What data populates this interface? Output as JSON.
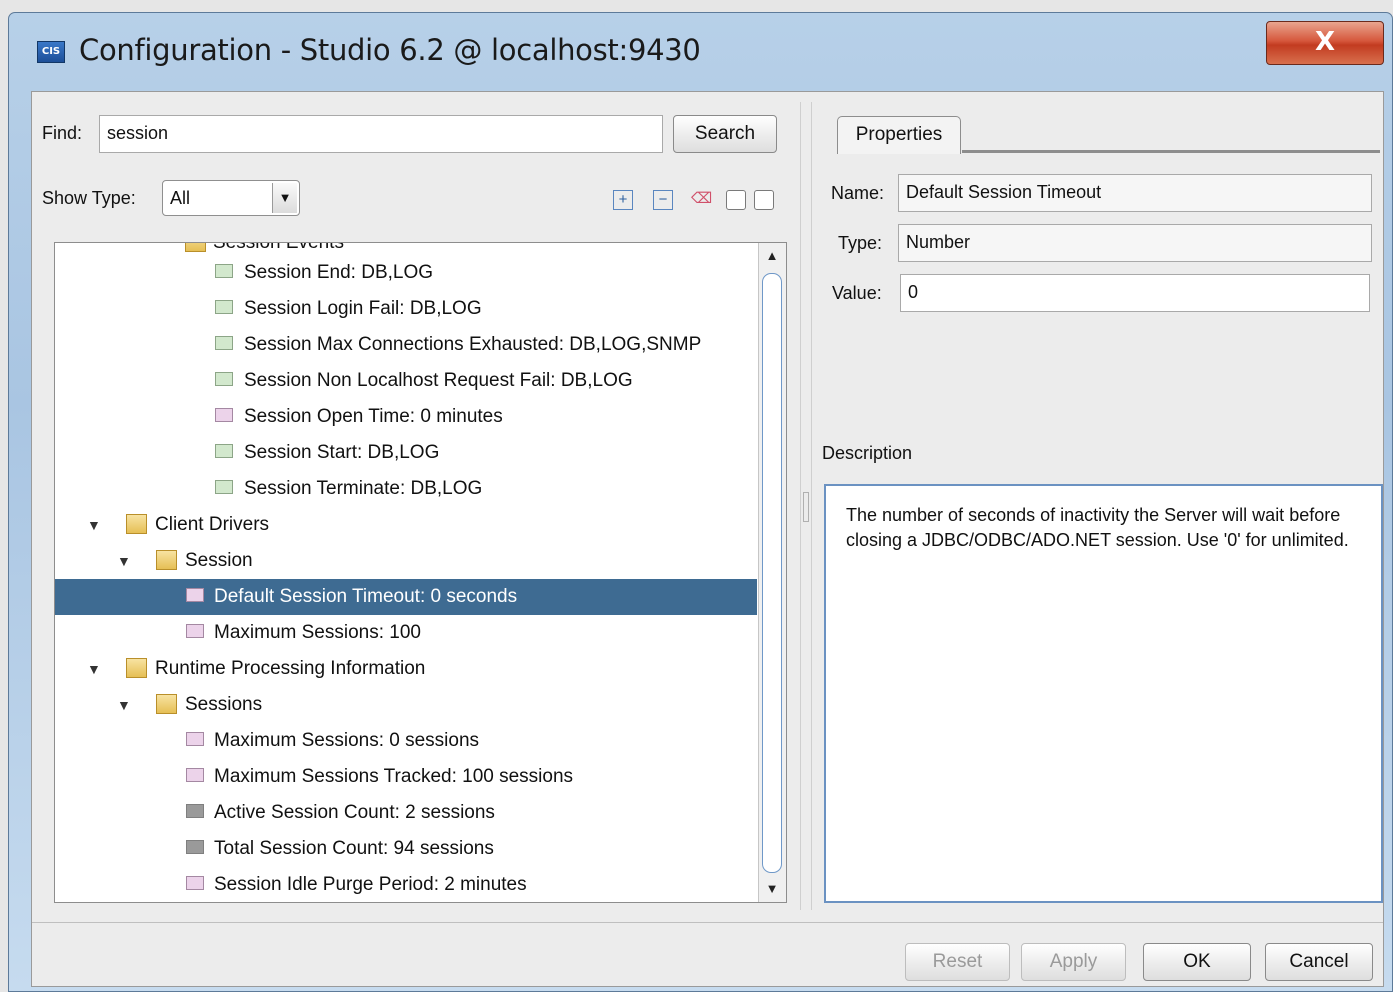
{
  "window": {
    "app_icon_text": "CIS",
    "title": "Configuration - Studio 6.2 @ localhost:9430",
    "close_label": "X"
  },
  "find": {
    "label": "Find:",
    "value": "session",
    "search_button": "Search"
  },
  "show_type": {
    "label": "Show Type:",
    "selected": "All"
  },
  "toolbar_icons": [
    "expand-all-icon",
    "collapse-all-icon",
    "eraser-icon",
    "checkbox-icon",
    "checkbox-icon"
  ],
  "tree": {
    "partial_row": "Session Events",
    "rows": [
      {
        "label": "Session End: DB,LOG",
        "icon": "cfg"
      },
      {
        "label": "Session Login Fail: DB,LOG",
        "icon": "cfg"
      },
      {
        "label": "Session Max Connections Exhausted: DB,LOG,SNMP",
        "icon": "cfg"
      },
      {
        "label": "Session Non Localhost Request Fail: DB,LOG",
        "icon": "cfg"
      },
      {
        "label": "Session Open Time: 0 minutes",
        "icon": "num"
      },
      {
        "label": "Session Start: DB,LOG",
        "icon": "cfg"
      },
      {
        "label": "Session Terminate: DB,LOG",
        "icon": "cfg"
      },
      {
        "label": "Client Drivers",
        "icon": "folder"
      },
      {
        "label": "Session",
        "icon": "folder"
      },
      {
        "label": "Default Session Timeout: 0 seconds",
        "icon": "num",
        "selected": true
      },
      {
        "label": "Maximum Sessions: 100",
        "icon": "num"
      },
      {
        "label": "Runtime Processing Information",
        "icon": "folder"
      },
      {
        "label": "Sessions",
        "icon": "folder"
      },
      {
        "label": "Maximum Sessions: 0 sessions",
        "icon": "num"
      },
      {
        "label": "Maximum Sessions Tracked: 100 sessions",
        "icon": "num"
      },
      {
        "label": "Active Session Count: 2 sessions",
        "icon": "stat"
      },
      {
        "label": "Total Session Count: 94 sessions",
        "icon": "stat"
      },
      {
        "label": "Session Idle Purge Period: 2 minutes",
        "icon": "num"
      }
    ]
  },
  "properties": {
    "tab_label": "Properties",
    "name_label": "Name:",
    "name_value": "Default Session Timeout",
    "type_label": "Type:",
    "type_value": "Number",
    "value_label": "Value:",
    "value_value": "0",
    "description_label": "Description",
    "description_text": "The number of seconds of inactivity the Server will wait before closing a JDBC/ODBC/ADO.NET session. Use '0' for unlimited."
  },
  "buttons": {
    "reset": "Reset",
    "apply": "Apply",
    "ok": "OK",
    "cancel": "Cancel"
  },
  "colors": {
    "selection": "#3e6b92",
    "close_button": "#c23b20",
    "description_border": "#6b92c2"
  }
}
